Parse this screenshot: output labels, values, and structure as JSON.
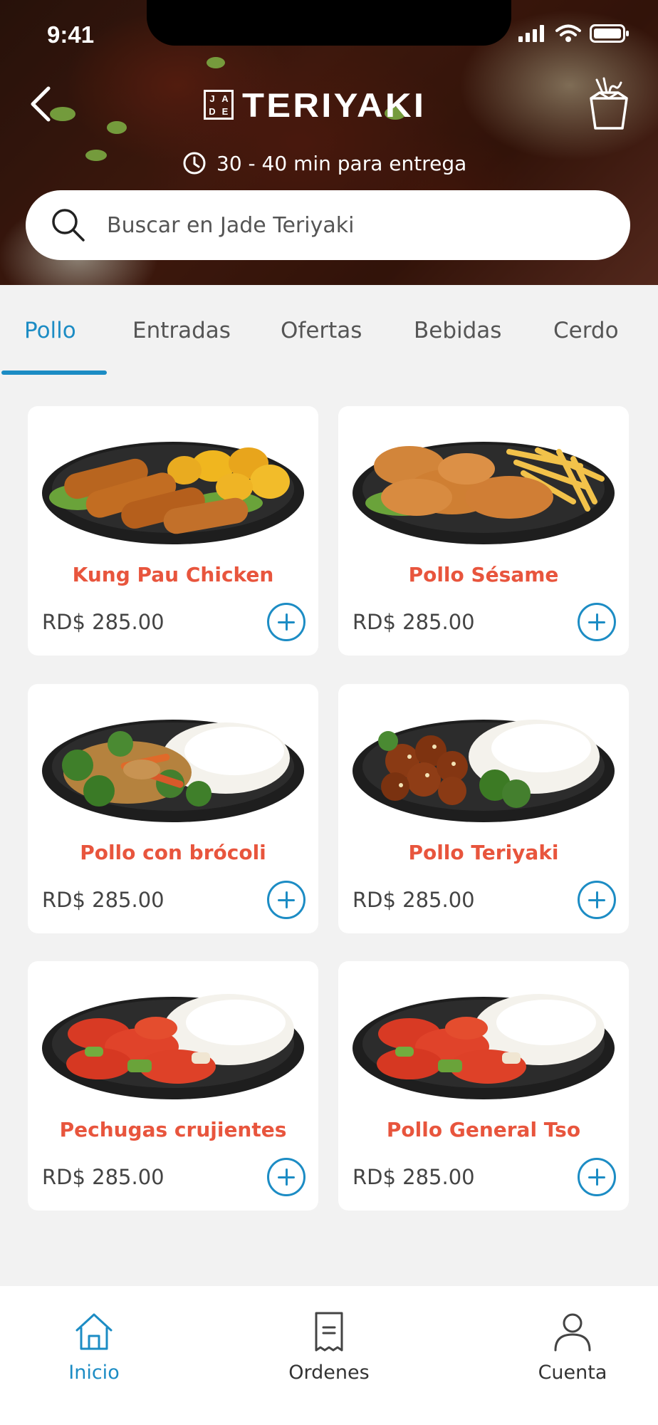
{
  "status_bar": {
    "time": "9:41"
  },
  "header": {
    "logo_mark": [
      "J",
      "A",
      "D",
      "E"
    ],
    "logo_text": "TERIYAKI",
    "delivery_time": "30 - 40 min para entrega"
  },
  "search": {
    "placeholder": "Buscar en Jade Teriyaki",
    "value": ""
  },
  "tabs": [
    {
      "label": "Pollo",
      "active": true
    },
    {
      "label": "Entradas",
      "active": false
    },
    {
      "label": "Ofertas",
      "active": false
    },
    {
      "label": "Bebidas",
      "active": false
    },
    {
      "label": "Cerdo",
      "active": false
    }
  ],
  "products": [
    {
      "name": "Kung Pau Chicken",
      "price": "RD$ 285.00",
      "image": "fried-chicken-plantains-plate"
    },
    {
      "name": "Pollo Sésame",
      "price": "RD$ 285.00",
      "image": "fried-chicken-fries-plate"
    },
    {
      "name": "Pollo con brócoli",
      "price": "RD$ 285.00",
      "image": "chicken-broccoli-rice-plate"
    },
    {
      "name": "Pollo Teriyaki",
      "price": "RD$ 285.00",
      "image": "teriyaki-chicken-rice-plate"
    },
    {
      "name": "Pechugas crujientes",
      "price": "RD$ 285.00",
      "image": "sweet-sour-chicken-rice-plate"
    },
    {
      "name": "Pollo General Tso",
      "price": "RD$ 285.00",
      "image": "general-tso-chicken-rice-plate"
    }
  ],
  "bottom_nav": [
    {
      "label": "Inicio",
      "icon": "home-icon",
      "active": true
    },
    {
      "label": "Ordenes",
      "icon": "receipt-icon",
      "active": false
    },
    {
      "label": "Cuenta",
      "icon": "user-icon",
      "active": false
    }
  ],
  "colors": {
    "accent": "#1c8cc4",
    "product_name": "#e8553d",
    "background": "#f2f2f2"
  }
}
